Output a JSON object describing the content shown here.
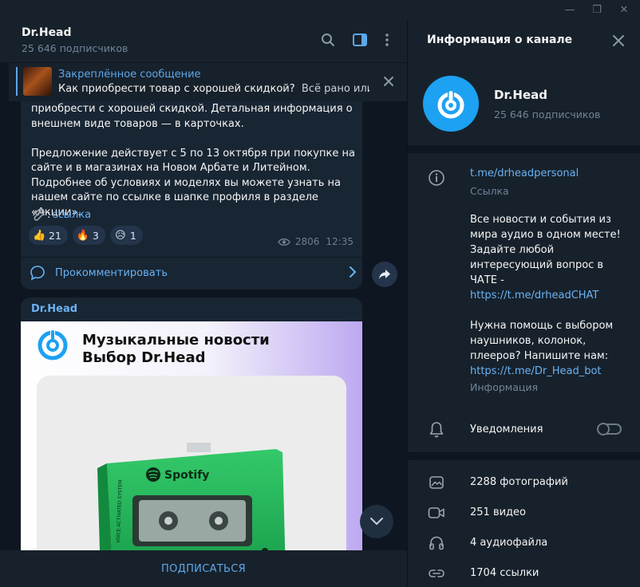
{
  "window": {
    "minimize": "—",
    "maximize": "❐",
    "close": "✕"
  },
  "chat": {
    "title": "Dr.Head",
    "subscribers": "25 646 подписчиков",
    "pinned": {
      "label": "Закреплённое сообщение",
      "title": "Как приобрести товар с хорошей скидкой?",
      "preview": "Всё рано или..."
    }
  },
  "message1": {
    "text1": "приобрести с хорошей скидкой. Детальная информация о внешнем виде товаров — в карточках.",
    "text2": "Предложение действует с 5 по 13 октября при покупке на сайте и в магазинах на Новом Арбате и Литейном. Подробнее об условиях и моделях вы можете узнать на нашем сайте по ссылке в шапке профиля в разделе «Акции».",
    "link_prefix": ":",
    "link_text": "ссылка",
    "reactions": [
      {
        "icon": "thumbs-up",
        "count": "21"
      },
      {
        "icon": "fire",
        "count": "3"
      },
      {
        "icon": "disappointed-face",
        "count": "1"
      }
    ],
    "views": "2806",
    "time": "12:35",
    "comment_label": "Прокомментировать"
  },
  "message2": {
    "author": "Dr.Head",
    "image_title_line1": "Музыкальные новости",
    "image_title_line2": "Выбор Dr.Head",
    "image_product_text": "Spotify",
    "image_side_text": "VOICE ACTIVATED SYSTEM"
  },
  "subscribe_label": "ПОДПИСАТЬСЯ",
  "info": {
    "title": "Информация о канале",
    "name": "Dr.Head",
    "subscribers": "25 646 подписчиков",
    "link": "t.me/drheadpersonal",
    "link_label": "Ссылка",
    "desc1": "Все новости и события из мира аудио в одном месте! Задайте любой интересующий вопрос в ЧАТЕ -",
    "desc1_link": "https://t.me/drheadCHAT",
    "desc2": "Нужна помощь с выбором наушников, колонок, плееров? Напишите нам:",
    "desc2_link": "https://t.me/Dr_Head_bot",
    "desc_label": "Информация",
    "notifications": "Уведомления",
    "notifications_on": false,
    "stats": {
      "photos": "2288 фотографий",
      "videos": "251 видео",
      "audio": "4 аудиофайла",
      "links": "1704 ссылки"
    }
  },
  "colors": {
    "accent": "#6ab2f2",
    "brand": "#1da1f2",
    "bg": "#0e1621",
    "panel": "#17212b",
    "bubble": "#182533"
  }
}
